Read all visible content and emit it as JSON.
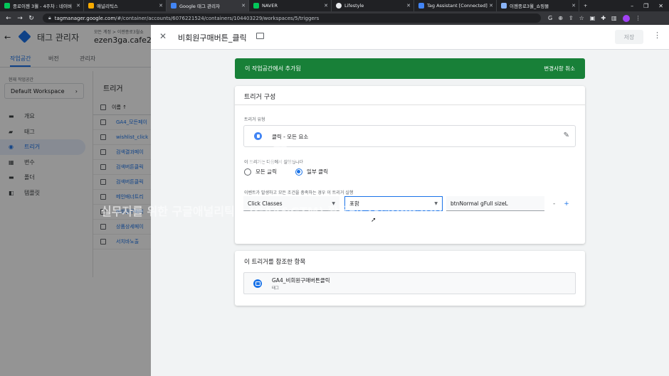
{
  "browser": {
    "tabs": [
      {
        "label": "종로이젠 3월 - 4주차 : 네이버",
        "color": "#03c75a"
      },
      {
        "label": "애널리틱스",
        "color": "#f9ab00"
      },
      {
        "label": "Google 태그 관리자",
        "color": "#4285f4",
        "active": true
      },
      {
        "label": "NAVER",
        "color": "#03c75a"
      },
      {
        "label": "Lifestyle",
        "color": "#e8eaed"
      },
      {
        "label": "Tag Assistant [Connected]",
        "color": "#4285f4"
      },
      {
        "label": "이젠종로3월_쇼핑몰",
        "color": "#8ab4f8"
      }
    ],
    "url_host": "tagmanager.google.com",
    "url_path": "/#/container/accounts/6076221524/containers/104403229/workspaces/5/triggers"
  },
  "app": {
    "title": "태그 관리자",
    "breadcrumb": "모든 계정 > 이젠종로3월쇼",
    "container": "ezen3ga.cafe2",
    "top_tabs": [
      "작업공간",
      "버전",
      "관리자"
    ],
    "workspace_label": "현재 작업공간",
    "workspace_value": "Default Workspace",
    "nav": [
      {
        "label": "개요",
        "icon": "▬"
      },
      {
        "label": "태그",
        "icon": "▰"
      },
      {
        "label": "트리거",
        "icon": "◉",
        "active": true
      },
      {
        "label": "변수",
        "icon": "▦"
      },
      {
        "label": "폴더",
        "icon": "▬"
      },
      {
        "label": "템플릿",
        "icon": "◧"
      }
    ],
    "triggers_title": "트리거",
    "triggers_col_header": "이름 ↑",
    "triggers": [
      "GA4_모든페이",
      "wishlist_click",
      "검색결과페이",
      "검색버튼클릭",
      "검색버튼클릭",
      "메인배너트리",
      "비회원구매버",
      "상품상세페이",
      "서치바노출"
    ]
  },
  "editor": {
    "title": "비회원구매버튼_클릭",
    "save_label": "저장",
    "banner_text": "이 작업공간에서 추가됨",
    "banner_action": "변경사항 취소",
    "config_title": "트리거 구성",
    "type_label": "트리거 유형",
    "type_value": "클릭 - 모든 요소",
    "fires_label": "이 트리거는 다음에서 실행됩니다",
    "radio_all": "모든 클릭",
    "radio_some": "일부 클릭",
    "condition_label": "이벤트가 발생하고 모든 조건을 충족하는 경우 이 트리거 실행",
    "condition_variable": "Click Classes",
    "condition_operator": "포함",
    "condition_value": "btnNormal gFull sizeL",
    "row_minus": "-",
    "row_plus": "+",
    "ref_title": "이 트리거를 참조한 항목",
    "ref_name": "GA4_비회원구매버튼클릭",
    "ref_type": "태그"
  },
  "watermark": {
    "logo": "inflearn",
    "line1": "실무자를 위한 구글애널리틱스 (GA4&GTM) 활용법(23년Update)",
    "line2": "GA4 Guide"
  },
  "colors": {
    "accent": "#1a73e8",
    "banner": "#188038"
  }
}
